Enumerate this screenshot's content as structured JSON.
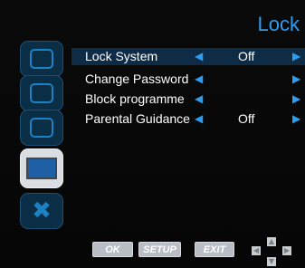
{
  "header": {
    "title": "Lock"
  },
  "sidebar": {
    "items": [
      {
        "icon": "picture-icon"
      },
      {
        "icon": "sound-icon"
      },
      {
        "icon": "channel-icon"
      },
      {
        "icon": "tv-lock-icon"
      },
      {
        "icon": "tools-icon"
      }
    ]
  },
  "menu": {
    "rows": [
      {
        "label": "Lock System",
        "value": "Off",
        "selected": true
      },
      {
        "label": "Change Password",
        "value": ""
      },
      {
        "label": "Block programme",
        "value": ""
      },
      {
        "label": "Parental Guidance",
        "value": "Off"
      }
    ]
  },
  "footer": {
    "ok_label": "OK",
    "setup_label": "SETUP",
    "exit_label": "EXIT"
  }
}
